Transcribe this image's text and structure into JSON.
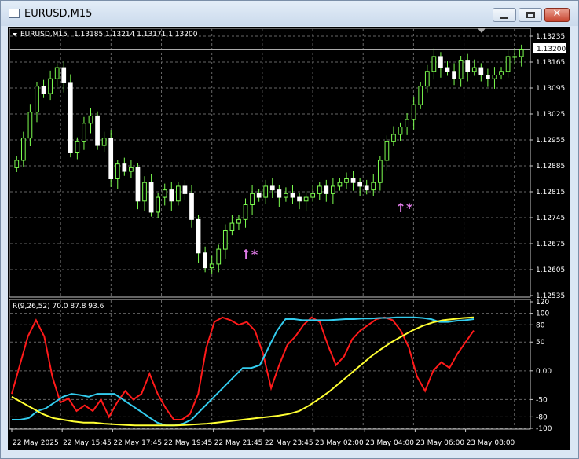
{
  "window": {
    "title": "EURUSD,M15",
    "minimize_icon": "minimize-icon",
    "maximize_icon": "maximize-icon",
    "close_glyph": "✕"
  },
  "chart_data": {
    "type": "candlestick",
    "symbol_label": "EURUSD,M15",
    "ohlc_label": "1.13185 1.13214 1.13171 1.13200",
    "current_price": "1.13200",
    "price_ticks": [
      "1.13235",
      "1.13165",
      "1.13095",
      "1.13025",
      "1.12955",
      "1.12885",
      "1.12815",
      "1.12745",
      "1.12675",
      "1.12605",
      "1.12535"
    ],
    "ylim": [
      1.12535,
      1.13235
    ],
    "closes": [
      1.129,
      1.1296,
      1.1303,
      1.131,
      1.1308,
      1.1312,
      1.1315,
      1.1311,
      1.1292,
      1.1295,
      1.13,
      1.1302,
      1.1294,
      1.1296,
      1.1285,
      1.1289,
      1.1287,
      1.1288,
      1.1279,
      1.1284,
      1.1276,
      1.128,
      1.1282,
      1.1279,
      1.1283,
      1.1281,
      1.1274,
      1.1265,
      1.1261,
      1.1262,
      1.1266,
      1.1271,
      1.1273,
      1.1274,
      1.1278,
      1.1281,
      1.128,
      1.1283,
      1.1282,
      1.128,
      1.1281,
      1.128,
      1.1279,
      1.128,
      1.1281,
      1.1283,
      1.1281,
      1.1283,
      1.1284,
      1.1285,
      1.1284,
      1.1283,
      1.1282,
      1.1284,
      1.129,
      1.1295,
      1.1297,
      1.1299,
      1.1301,
      1.1305,
      1.131,
      1.1314,
      1.1318,
      1.1315,
      1.1314,
      1.1312,
      1.1317,
      1.1314,
      1.1315,
      1.1313,
      1.1312,
      1.1313,
      1.1314,
      1.1318,
      1.1318,
      1.132
    ],
    "markers": [
      {
        "index": 34,
        "price": 1.12635,
        "symbol": "↑*"
      },
      {
        "index": 57,
        "price": 1.1276,
        "symbol": "↑*"
      }
    ],
    "time_labels": [
      "22 May 2025",
      "22 May 15:45",
      "22 May 17:45",
      "22 May 19:45",
      "22 May 21:45",
      "22 May 23:45",
      "23 May 02:00",
      "23 May 04:00",
      "23 May 06:00",
      "23 May 08:00"
    ],
    "indicator": {
      "label": "R(9,26,52) 70.0 87.8 93.6",
      "ticks": [
        "120",
        "100",
        "80",
        "50",
        "0.00",
        "-50",
        "-80",
        "-100"
      ],
      "ylim": [
        -100,
        120
      ],
      "series": [
        {
          "color": "#ff1a1a",
          "values": [
            -40,
            10,
            60,
            88,
            60,
            -10,
            -55,
            -48,
            -70,
            -60,
            -70,
            -50,
            -80,
            -55,
            -35,
            -50,
            -40,
            -5,
            -40,
            -65,
            -85,
            -85,
            -75,
            -40,
            40,
            85,
            93,
            88,
            80,
            85,
            70,
            30,
            -30,
            10,
            45,
            60,
            80,
            93,
            85,
            45,
            10,
            25,
            55,
            70,
            80,
            90,
            93,
            88,
            70,
            40,
            -10,
            -35,
            0,
            15,
            5,
            30,
            50,
            70
          ]
        },
        {
          "color": "#33ccee",
          "values": [
            -85,
            -85,
            -82,
            -70,
            -65,
            -55,
            -45,
            -40,
            -42,
            -45,
            -40,
            -40,
            -40,
            -50,
            -60,
            -70,
            -80,
            -90,
            -95,
            -95,
            -92,
            -85,
            -70,
            -55,
            -40,
            -25,
            -10,
            5,
            5,
            10,
            40,
            70,
            90,
            90,
            88,
            88,
            88,
            88,
            89,
            90,
            90,
            91,
            91,
            92,
            92,
            93,
            93,
            93,
            92,
            90,
            85,
            85,
            87,
            88,
            90
          ]
        },
        {
          "color": "#ffff33",
          "values": [
            -45,
            -55,
            -65,
            -75,
            -82,
            -85,
            -88,
            -90,
            -90,
            -92,
            -93,
            -94,
            -95,
            -95,
            -95,
            -95,
            -95,
            -94,
            -93,
            -92,
            -90,
            -88,
            -86,
            -84,
            -82,
            -80,
            -78,
            -75,
            -70,
            -60,
            -48,
            -35,
            -20,
            -5,
            10,
            25,
            38,
            50,
            60,
            70,
            78,
            84,
            88,
            90,
            92,
            93
          ]
        }
      ]
    }
  }
}
